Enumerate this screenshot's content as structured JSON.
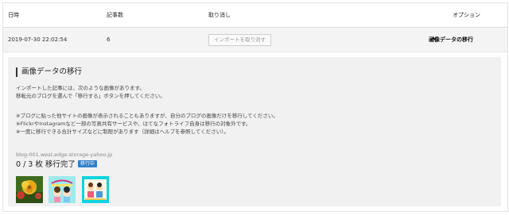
{
  "table": {
    "headers": {
      "date": "日時",
      "count": "記事数",
      "cancel": "取り消し",
      "options": "オプション"
    },
    "row": {
      "date": "2019-07-30 22:02:54",
      "count": "6",
      "import_button": "インポートを取り消す",
      "option_link": "画像データの移行"
    }
  },
  "migration": {
    "title": "画像データの移行",
    "line1": "インポートした記事には、次のような画像があります。",
    "line2": "移転元のブログを選んで「移行する」ボタンを押してください。",
    "note1": "※ブログに貼った他サイトの画像が表示されることもありますが、自分のブログの画像だけを移行してください。",
    "note2": "※FlickrやInstagramなど一部の写真共有サービスや、はてなフォトライフ自身は移行の対象外です。",
    "note3": "※一度に移行できる合計サイズなどに制限があります（詳細はヘルプを参照してください）。",
    "host": "blog-001.west.edge.storage-yahoo.jp",
    "progress_text": "0 / 3 枚 移行完了",
    "status_badge": "移行中"
  },
  "colors": {
    "badge": "#2f7fc7",
    "panel_bg": "#f1f1f1"
  },
  "icons": {
    "chevron": "chevron-up-icon"
  }
}
